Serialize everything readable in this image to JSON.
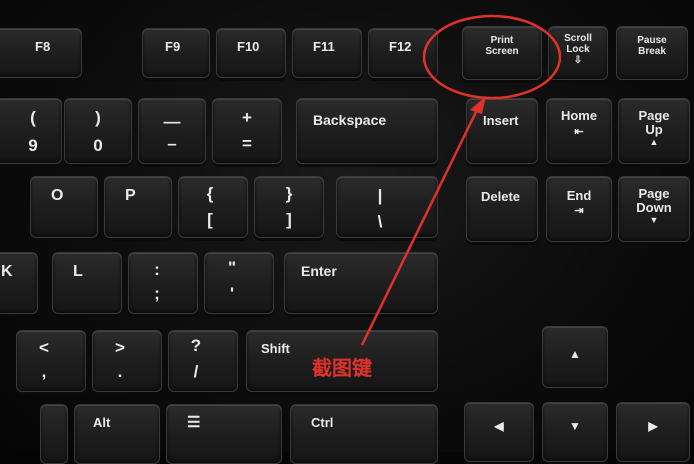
{
  "keys": {
    "f8": "F8",
    "f9": "F9",
    "f10": "F10",
    "f11": "F11",
    "f12": "F12",
    "print_top": "Print",
    "print_bot": "Screen",
    "scroll_top": "Scroll",
    "scroll_bot": "Lock",
    "scroll_icon": "⇩",
    "pause_top": "Pause",
    "pause_bot": "Break",
    "nine_top": "(",
    "nine_bot": "9",
    "zero_top": ")",
    "zero_bot": "0",
    "minus_top": "—",
    "minus_bot": "–",
    "plus_top": "+",
    "plus_bot": "=",
    "backspace": "Backspace",
    "insert": "Insert",
    "home": "Home",
    "home_icon": "⇤",
    "pageup_top": "Page",
    "pageup_bot": "Up",
    "pageup_icon": "▲",
    "o": "O",
    "p": "P",
    "brace_top": "{",
    "brace_bot": "[",
    "rbrace_top": "}",
    "rbrace_bot": "]",
    "pipe_top": "|",
    "pipe_bot": "\\",
    "delete": "Delete",
    "end": "End",
    "end_icon": "⇥",
    "pagedown_top": "Page",
    "pagedown_bot": "Down",
    "pagedown_icon": "▼",
    "k": "K",
    "l": "L",
    "semi_top": ":",
    "semi_bot": ";",
    "quote_top": "\"",
    "quote_bot": "'",
    "enter": "Enter",
    "lt_top": "<",
    "lt_bot": ",",
    "gt_top": ">",
    "gt_bot": ".",
    "q_top": "?",
    "q_bot": "/",
    "shift": "Shift",
    "alt": "Alt",
    "menu_icon": "☰",
    "ctrl": "Ctrl",
    "up": "▲",
    "left": "◀",
    "down": "▼",
    "right": "▶"
  },
  "annotation": {
    "label": "截图键",
    "color": "#e0322a"
  }
}
